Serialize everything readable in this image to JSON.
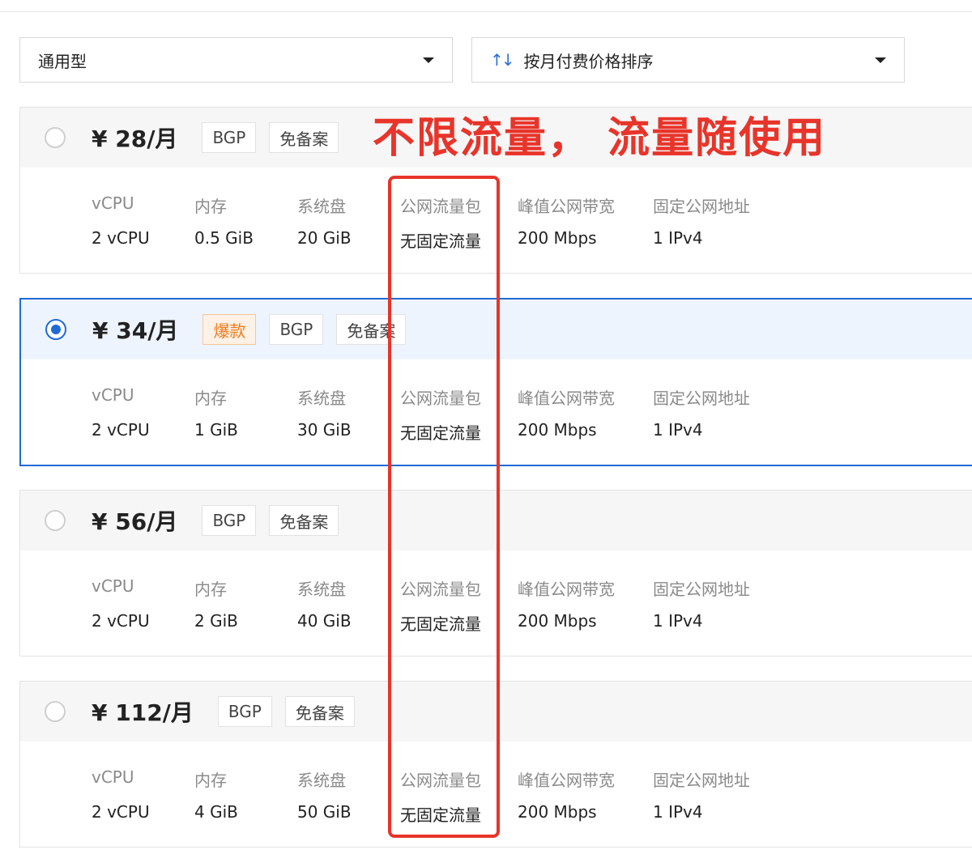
{
  "filters": {
    "type_select": "通用型",
    "sort_select": "按月付费价格排序"
  },
  "annotation": "不限流量，  流量随使用",
  "spec_labels": [
    "vCPU",
    "内存",
    "系统盘",
    "公网流量包",
    "峰值公网带宽",
    "固定公网地址"
  ],
  "plans": [
    {
      "price": "¥ 28/月",
      "selected": false,
      "tags": [
        "BGP",
        "免备案"
      ],
      "specs": [
        "2 vCPU",
        "0.5 GiB",
        "20 GiB",
        "无固定流量",
        "200 Mbps",
        "1 IPv4"
      ]
    },
    {
      "price": "¥ 34/月",
      "selected": true,
      "hot_tag": "爆款",
      "tags": [
        "BGP",
        "免备案"
      ],
      "specs": [
        "2 vCPU",
        "1 GiB",
        "30 GiB",
        "无固定流量",
        "200 Mbps",
        "1 IPv4"
      ]
    },
    {
      "price": "¥ 56/月",
      "selected": false,
      "tags": [
        "BGP",
        "免备案"
      ],
      "specs": [
        "2 vCPU",
        "2 GiB",
        "40 GiB",
        "无固定流量",
        "200 Mbps",
        "1 IPv4"
      ]
    },
    {
      "price": "¥ 112/月",
      "selected": false,
      "tags": [
        "BGP",
        "免备案"
      ],
      "specs": [
        "2 vCPU",
        "4 GiB",
        "50 GiB",
        "无固定流量",
        "200 Mbps",
        "1 IPv4"
      ]
    }
  ],
  "colors": {
    "accent": "#1f6bd6",
    "annotation_red": "#e8342a",
    "hot_tag": "#f07a1a"
  }
}
